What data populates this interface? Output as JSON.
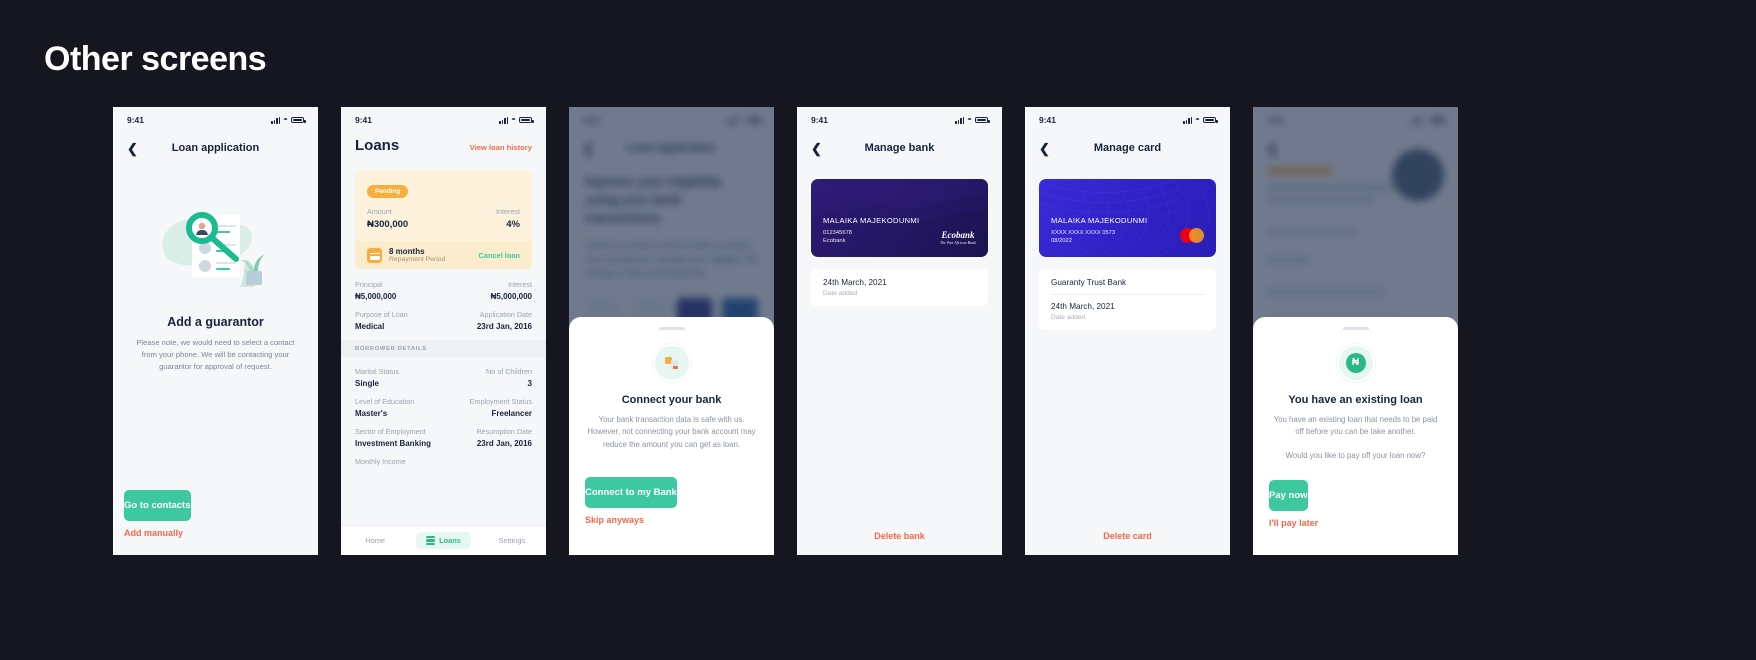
{
  "header": {
    "title": "Other screens"
  },
  "accent": {
    "green": "#3dc8a0",
    "orange": "#f4694a",
    "amber": "#f8ae3c",
    "navy": "#17233e",
    "bg": "#15161f"
  },
  "status_bar": {
    "time": "9:41"
  },
  "screens": [
    {
      "id": "add-guarantor",
      "nav_title": "Loan application",
      "empty_title": "Add a guarantor",
      "empty_body": "Please note, we would need to select a contact from your phone. We will be contacting your guarantor for approval of request.",
      "primary_label": "Go to contacts",
      "secondary_label": "Add manually"
    },
    {
      "id": "loans",
      "title": "Loans",
      "view_history": "View loan history",
      "card": {
        "status": "Pending",
        "amount_label": "Amount",
        "amount_value": "₦300,000",
        "interest_label": "Interest",
        "interest_value": "4%",
        "term": "8 months",
        "term_sub": "Repayment Period",
        "cancel_label": "Cancel loan"
      },
      "details": [
        {
          "left_k": "Principal",
          "left_v": "₦5,000,000",
          "right_k": "Interest",
          "right_v": "₦5,000,000"
        },
        {
          "left_k": "Purpose of Loan",
          "left_v": "Medical",
          "right_k": "Application Date",
          "right_v": "23rd Jan, 2016"
        }
      ],
      "section_label": "BORROWER DETAILS",
      "borrower": [
        {
          "left_k": "Marital Status",
          "left_v": "Single",
          "right_k": "No of Children",
          "right_v": "3"
        },
        {
          "left_k": "Level of Education",
          "left_v": "Master's",
          "right_k": "Employment Status",
          "right_v": "Freelancer"
        },
        {
          "left_k": "Sector of Employment",
          "left_v": "Investment Banking",
          "right_k": "Resumption Date",
          "right_v": "23rd Jan, 2016"
        },
        {
          "left_k": "Monthly Income",
          "left_v": "",
          "right_k": "",
          "right_v": ""
        }
      ],
      "tabs": [
        {
          "label": "Home",
          "active": false
        },
        {
          "label": "Loans",
          "active": true
        },
        {
          "label": "Settings",
          "active": false
        }
      ]
    },
    {
      "id": "connect-bank",
      "backdrop": {
        "nav_title": "Loan Application",
        "heading": "Improve your eligibility using your bank transactions.",
        "body": "Connect your bank account to allow us analyse your transactions to calculate your eligibility. This will help us offer you the best offer."
      },
      "sheet": {
        "icon": "documents-icon",
        "title": "Connect your bank",
        "body": "Your bank transaction data is safe with us. However, not connecting your bank account may reduce the amount you can get as loan.",
        "primary_label": "Connect to my Bank",
        "secondary_label": "Skip anyways"
      }
    },
    {
      "id": "manage-bank",
      "nav_title": "Manage bank",
      "card": {
        "holder": "MALAIKA MAJEKODUNMI",
        "line1": "012345678",
        "line2": "Ecobank",
        "brand": "Ecobank",
        "brand_tagline": "The Pan African Bank"
      },
      "info_main": "24th March, 2021",
      "info_sub": "Date added",
      "danger_label": "Delete bank"
    },
    {
      "id": "manage-card",
      "nav_title": "Manage card",
      "card": {
        "holder": "MALAIKA MAJEKODUNMI",
        "line1": "XXXX XXXX XXXX 0573",
        "line2": "08/2022",
        "brand": "mastercard-logo"
      },
      "info_main": "Guaranty Trust Bank",
      "info_second": "24th March, 2021",
      "info_sub": "Date added",
      "danger_label": "Delete card"
    },
    {
      "id": "existing-loan",
      "sheet": {
        "icon": "naira-check-icon",
        "title": "You have an existing loan",
        "body1": "You have an existing loan that needs to be paid off before you can be take another.",
        "body2": "Would you like to pay off your loan now?",
        "primary_label": "Pay now",
        "secondary_label": "I'll pay later"
      }
    }
  ]
}
